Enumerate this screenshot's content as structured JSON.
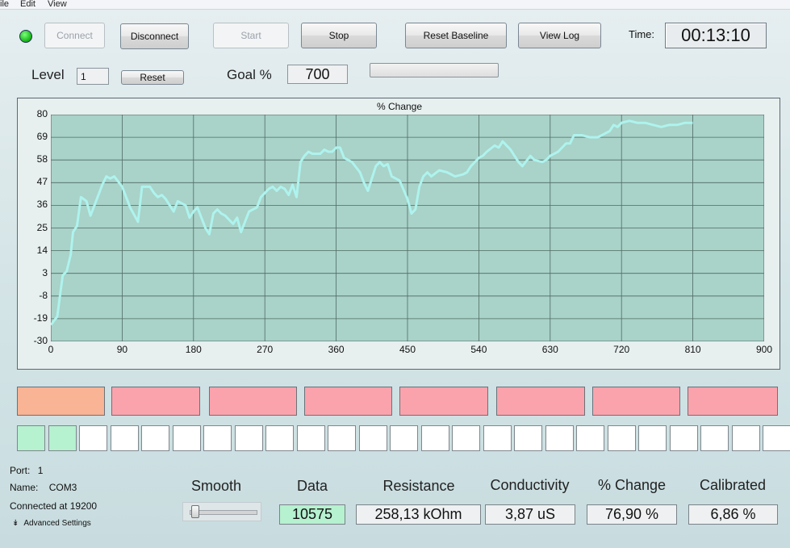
{
  "menu": [
    "ile",
    "Edit",
    "View"
  ],
  "toolbar": {
    "connect": "Connect",
    "disconnect": "Disconnect",
    "start": "Start",
    "stop": "Stop",
    "reset_baseline": "Reset Baseline",
    "view_log": "View Log",
    "time_label": "Time:",
    "time_value": "00:13:10"
  },
  "level": {
    "label": "Level",
    "value": "1",
    "reset": "Reset"
  },
  "goal": {
    "label": "Goal %",
    "value": "700"
  },
  "chart_data": {
    "type": "line",
    "title": "% Change",
    "xlim": [
      0,
      900
    ],
    "ylim": [
      -30,
      80
    ],
    "x_ticks": [
      "0",
      "90",
      "180",
      "270",
      "360",
      "450",
      "540",
      "630",
      "720",
      "810",
      "900"
    ],
    "y_ticks": [
      "80",
      "69",
      "58",
      "47",
      "36",
      "25",
      "14",
      "3",
      "-8",
      "-19",
      "-30"
    ],
    "grid": true,
    "line_color": "#aef3ee",
    "plot_bg": "#a9d2c8",
    "series": [
      {
        "x": [
          0,
          8,
          15,
          20,
          25,
          28,
          33,
          38,
          45,
          50,
          57,
          65,
          70,
          75,
          80,
          90,
          95,
          100,
          110,
          115,
          125,
          130,
          135,
          140,
          145,
          150,
          155,
          160,
          170,
          175,
          180,
          185,
          195,
          200,
          205,
          210,
          215,
          220,
          230,
          235,
          240,
          245,
          250,
          255,
          260,
          265,
          270,
          275,
          280,
          285,
          290,
          295,
          300,
          305,
          310,
          315,
          320,
          325,
          330,
          340,
          345,
          350,
          355,
          360,
          365,
          370,
          380,
          390,
          395,
          400,
          410,
          415,
          420,
          425,
          430,
          440,
          450,
          455,
          460,
          465,
          470,
          475,
          480,
          490,
          500,
          510,
          520,
          525,
          530,
          540,
          545,
          550,
          560,
          565,
          570,
          580,
          590,
          595,
          605,
          610,
          620,
          625,
          630,
          640,
          650,
          655,
          660,
          670,
          680,
          690,
          700,
          705,
          710,
          715,
          720,
          730,
          740,
          750,
          760,
          770,
          780,
          790,
          800,
          810
        ],
        "y": [
          -22,
          -18,
          2,
          4,
          12,
          23,
          26,
          40,
          38,
          31,
          38,
          46,
          50,
          49,
          50,
          45,
          40,
          35,
          28,
          45,
          45,
          42,
          40,
          41,
          39,
          36,
          33,
          38,
          36,
          30,
          33,
          35,
          25,
          22,
          32,
          34,
          32,
          31,
          27,
          30,
          23,
          28,
          33,
          34,
          35,
          40,
          42,
          44,
          45,
          43,
          45,
          44,
          41,
          46,
          40,
          57,
          60,
          62,
          61,
          61,
          63,
          62,
          62,
          64,
          64,
          59,
          57,
          52,
          47,
          43,
          55,
          57,
          55,
          56,
          50,
          48,
          39,
          32,
          34,
          45,
          50,
          52,
          50,
          53,
          52,
          50,
          51,
          52,
          55,
          59,
          60,
          62,
          65,
          64,
          67,
          63,
          57,
          55,
          60,
          58,
          57,
          58,
          60,
          62,
          66,
          66,
          70,
          70,
          69,
          69,
          71,
          72,
          75,
          74,
          76,
          77,
          76,
          76,
          75,
          74,
          75,
          75,
          76,
          76
        ]
      }
    ]
  },
  "meters": {
    "segments": [
      "warm",
      "pink",
      "pink",
      "pink",
      "pink",
      "pink",
      "pink",
      "pink"
    ],
    "squares_on": 2,
    "squares_total": 25,
    "seg_colors": {
      "warm": "#f8b495",
      "pink": "#fba3ad",
      "sq_on": "#b6f1d0"
    }
  },
  "info": {
    "port_label": "Port:",
    "port_value": "1",
    "name_label": "Name:",
    "name_value": "COM3",
    "connected": "Connected at 19200",
    "advanced": "Advanced Settings"
  },
  "smooth": {
    "label": "Smooth",
    "level": 0.05
  },
  "readouts": [
    {
      "label": "Data",
      "value": "10575"
    },
    {
      "label": "Resistance",
      "value": "258,13 kOhm"
    },
    {
      "label": "Conductivity",
      "value": "3,87 uS"
    },
    {
      "label": "% Change",
      "value": "76,90 %"
    },
    {
      "label": "Calibrated",
      "value": "6,86 %"
    }
  ]
}
